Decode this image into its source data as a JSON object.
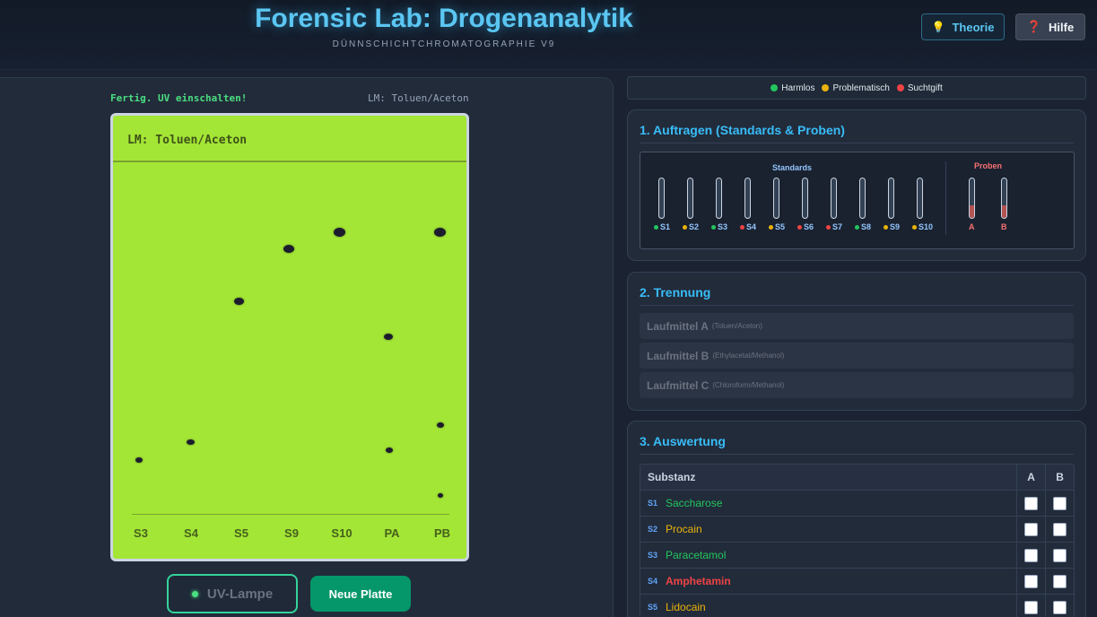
{
  "header": {
    "title": "Forensic Lab: Drogenanalytik",
    "subtitle": "DÜNNSCHICHTCHROMATOGRAPHIE V9",
    "theory_label": "Theorie",
    "help_label": "Hilfe",
    "theory_icon": "lightbulb-icon",
    "help_icon": "question-icon"
  },
  "plate_panel": {
    "status": "Fertig. UV einschalten!",
    "solvent_info": "LM: Toluen/Aceton",
    "plate_label": "LM: Toluen/Aceton",
    "lanes": [
      "S3",
      "S4",
      "S5",
      "S9",
      "S10",
      "PA",
      "PB"
    ],
    "uv_label": "UV-Lampe",
    "new_plate_label": "Neue Platte"
  },
  "legend": {
    "harmless": "Harmlos",
    "problematic": "Problematisch",
    "addictive": "Suchtgift"
  },
  "colors": {
    "harmless": "#22c55e",
    "problematic": "#eab308",
    "addictive": "#ef4444",
    "accent": "#38bdf8",
    "plate": "#a3e635"
  },
  "step1": {
    "title": "1. Auftragen (Standards & Proben)",
    "standards_label": "Standards",
    "samples_label": "Proben",
    "standards": [
      {
        "id": "S1",
        "cat": "harmless"
      },
      {
        "id": "S2",
        "cat": "problematic"
      },
      {
        "id": "S3",
        "cat": "harmless"
      },
      {
        "id": "S4",
        "cat": "addictive"
      },
      {
        "id": "S5",
        "cat": "problematic"
      },
      {
        "id": "S6",
        "cat": "addictive"
      },
      {
        "id": "S7",
        "cat": "addictive"
      },
      {
        "id": "S8",
        "cat": "harmless"
      },
      {
        "id": "S9",
        "cat": "problematic"
      },
      {
        "id": "S10",
        "cat": "problematic"
      }
    ],
    "samples": [
      "A",
      "B"
    ]
  },
  "step2": {
    "title": "2. Trennung",
    "solvents": [
      {
        "name": "Laufmittel A",
        "sub": "(Toluen/Aceton)"
      },
      {
        "name": "Laufmittel B",
        "sub": "(Ethylacetat/Methanol)"
      },
      {
        "name": "Laufmittel C",
        "sub": "(Chloroform/Methanol)"
      }
    ]
  },
  "step3": {
    "title": "3. Auswertung",
    "col_substance": "Substanz",
    "col_a": "A",
    "col_b": "B",
    "rows": [
      {
        "id": "S1",
        "name": "Saccharose",
        "cat": "harmless"
      },
      {
        "id": "S2",
        "name": "Procain",
        "cat": "problematic"
      },
      {
        "id": "S3",
        "name": "Paracetamol",
        "cat": "harmless"
      },
      {
        "id": "S4",
        "name": "Amphetamin",
        "cat": "addictive"
      },
      {
        "id": "S5",
        "name": "Lidocain",
        "cat": "problematic"
      }
    ]
  }
}
